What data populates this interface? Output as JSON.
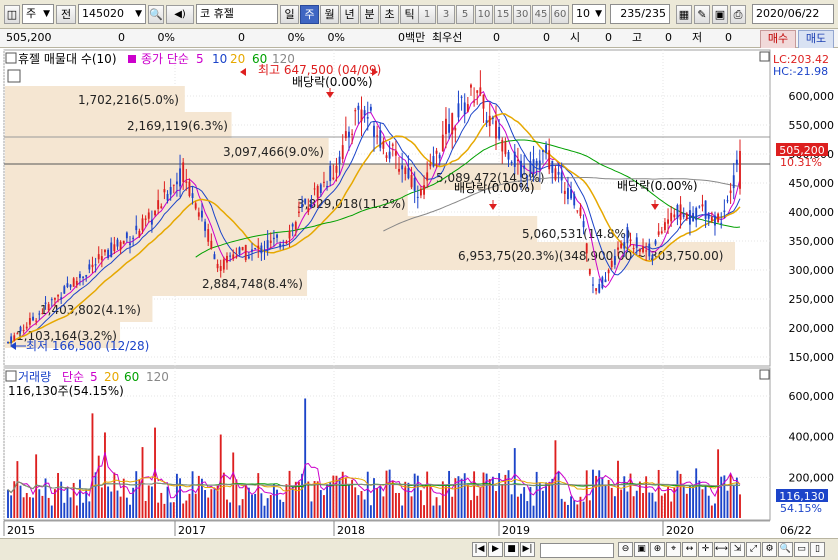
{
  "toolbar": {
    "market": "주",
    "prev": "전",
    "code": "145020",
    "sound": "◀)",
    "code_prefix": "코",
    "stock_name": "휴젤",
    "periods": [
      "일",
      "주",
      "월",
      "년",
      "분",
      "초",
      "틱"
    ],
    "active_period": "주",
    "numbers": [
      "1",
      "3",
      "5",
      "10",
      "15",
      "30",
      "45",
      "60"
    ],
    "count_select": "10",
    "count_display": "235/235",
    "date": "2020/06/22"
  },
  "quote": {
    "price": "505,200",
    "change": "0",
    "change_pct": "0%",
    "volume": "0",
    "volume_pct": "0%",
    "amount_pct": "0%",
    "unit": "0백만",
    "best_label": "최우선",
    "best1": "0",
    "best2": "0",
    "open_label": "시",
    "open": "0",
    "high_label": "고",
    "high": "0",
    "low_label": "저",
    "low": "0",
    "buy": "매수",
    "sell": "매도"
  },
  "colors": {
    "up": "#dd1f1f",
    "down": "#1c44c9",
    "ma5": "#cc00cc",
    "ma10": "#1c44c9",
    "ma20": "#e6a800",
    "ma60": "#00a000",
    "ma120": "#888888",
    "band": "#f5e6d2"
  },
  "price_panel": {
    "legend_name": "휴젤 매물대 수(10)",
    "legend_ma": "종가 단순",
    "periods": [
      "5",
      "10",
      "20",
      "60",
      "120"
    ],
    "lc": "LC:203.42",
    "hc": "HC:-21.98",
    "current": "505,200",
    "current_pct": "10.31%",
    "high_label": "최고 647,500 (04/09)",
    "low_label": "최저 166,500 (12/28)",
    "dividend_label": "배당락(0.00%)",
    "y_ticks": [
      "600,000",
      "550,000",
      "500,000",
      "450,000",
      "400,000",
      "350,000",
      "300,000",
      "250,000",
      "200,000",
      "150,000"
    ],
    "bands": [
      {
        "label": "1,702,216(5.0%)",
        "pct": 5.0
      },
      {
        "label": "2,169,119(6.3%)",
        "pct": 6.3
      },
      {
        "label": "3,097,466(9.0%)",
        "pct": 9.0
      },
      {
        "label": "5,089,472(14.9%)",
        "pct": 14.9
      },
      {
        "label": "3,829,018(11.2%)",
        "pct": 11.2
      },
      {
        "label": "5,060,531(14.8%)",
        "pct": 14.8
      },
      {
        "label": "6,953,75(20.3%)(348,900.00 ~ 303,750.00)",
        "pct": 20.3
      },
      {
        "label": "2,884,748(8.4%)",
        "pct": 8.4
      },
      {
        "label": "1,403,802(4.1%)",
        "pct": 4.1
      },
      {
        "label": "1,103,164(3.2%)",
        "pct": 3.2
      }
    ]
  },
  "volume_panel": {
    "legend_name": "거래량",
    "legend_ma": "단순",
    "periods": [
      "5",
      "20",
      "60",
      "120"
    ],
    "info": "116,130주(54.15%)",
    "current": "116,130",
    "current_pct": "54.15%",
    "y_ticks": [
      "600,000",
      "400,000",
      "200,000"
    ]
  },
  "x_axis": [
    "2015",
    "2017",
    "2018",
    "2019",
    "2020"
  ],
  "x_axis_right": "06/22",
  "chart_data": {
    "type": "candlestick",
    "interval": "weekly",
    "total_bars": 235,
    "price_range": [
      150000,
      650000
    ],
    "volume_range": [
      0,
      650000
    ],
    "high": 647500,
    "low": 166500,
    "last_close": 505200,
    "last_volume": 116130
  }
}
